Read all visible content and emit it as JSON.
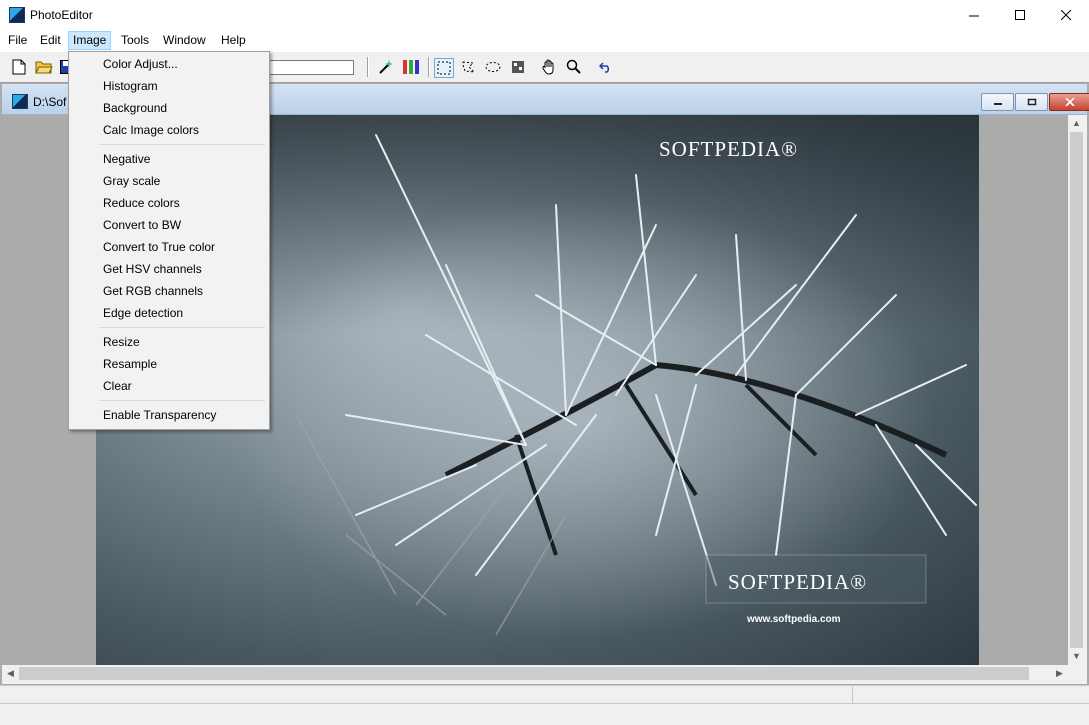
{
  "window": {
    "title": "PhotoEditor",
    "minimize_glyph": "—",
    "maximize_glyph": "☐",
    "close_glyph": "✕"
  },
  "menubar": [
    {
      "label": "File",
      "active": false
    },
    {
      "label": "Edit",
      "active": false
    },
    {
      "label": "Image",
      "active": true
    },
    {
      "label": "Tools",
      "active": false
    },
    {
      "label": "Window",
      "active": false
    },
    {
      "label": "Help",
      "active": false
    }
  ],
  "toolbar": {
    "icons": [
      "new-file-icon",
      "open-folder-icon",
      "save-icon",
      "magic-wand-icon",
      "color-channels-icon",
      "rect-select-icon",
      "lasso-select-icon",
      "ellipse-select-icon",
      "stamp-icon",
      "hand-icon",
      "zoom-icon",
      "undo-icon"
    ]
  },
  "child_window": {
    "path": "D:\\Sof"
  },
  "image_menu": {
    "groups": [
      [
        "Color Adjust...",
        "Histogram",
        "Background",
        "Calc Image colors"
      ],
      [
        "Negative",
        "Gray scale",
        "Reduce colors",
        "Convert to BW",
        "Convert to True color",
        "Get HSV channels",
        "Get RGB channels",
        "Edge detection"
      ],
      [
        "Resize",
        "Resample",
        "Clear"
      ],
      [
        "Enable Transparency"
      ]
    ]
  },
  "photo": {
    "watermark_top": "SOFTPEDIA®",
    "watermark_bottom": "SOFTPEDIA®",
    "watermark_url": "www.softpedia.com"
  },
  "colors": {
    "menu_highlight": "#cce8ff",
    "child_title": "#c6dbf0"
  }
}
